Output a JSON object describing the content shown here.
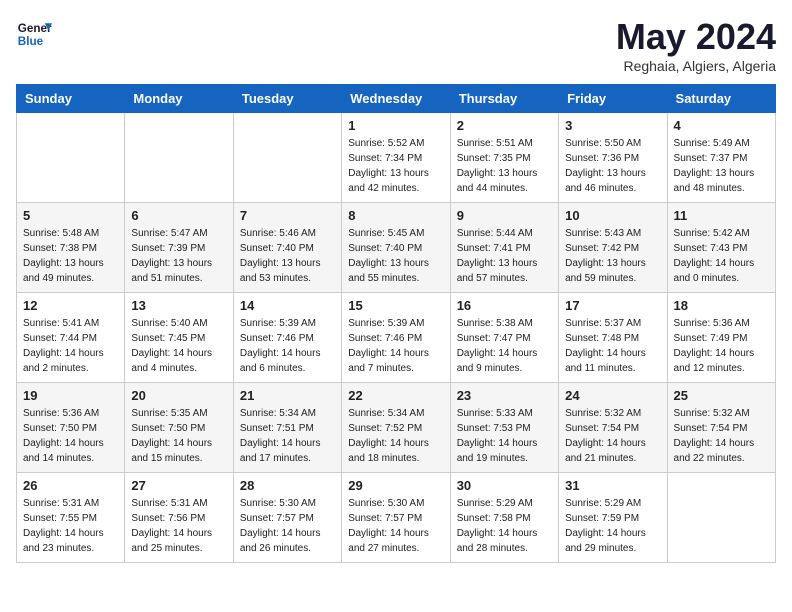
{
  "header": {
    "logo_line1": "General",
    "logo_line2": "Blue",
    "month_year": "May 2024",
    "location": "Reghaia, Algiers, Algeria"
  },
  "days_of_week": [
    "Sunday",
    "Monday",
    "Tuesday",
    "Wednesday",
    "Thursday",
    "Friday",
    "Saturday"
  ],
  "weeks": [
    [
      {
        "day": "",
        "info": ""
      },
      {
        "day": "",
        "info": ""
      },
      {
        "day": "",
        "info": ""
      },
      {
        "day": "1",
        "info": "Sunrise: 5:52 AM\nSunset: 7:34 PM\nDaylight: 13 hours\nand 42 minutes."
      },
      {
        "day": "2",
        "info": "Sunrise: 5:51 AM\nSunset: 7:35 PM\nDaylight: 13 hours\nand 44 minutes."
      },
      {
        "day": "3",
        "info": "Sunrise: 5:50 AM\nSunset: 7:36 PM\nDaylight: 13 hours\nand 46 minutes."
      },
      {
        "day": "4",
        "info": "Sunrise: 5:49 AM\nSunset: 7:37 PM\nDaylight: 13 hours\nand 48 minutes."
      }
    ],
    [
      {
        "day": "5",
        "info": "Sunrise: 5:48 AM\nSunset: 7:38 PM\nDaylight: 13 hours\nand 49 minutes."
      },
      {
        "day": "6",
        "info": "Sunrise: 5:47 AM\nSunset: 7:39 PM\nDaylight: 13 hours\nand 51 minutes."
      },
      {
        "day": "7",
        "info": "Sunrise: 5:46 AM\nSunset: 7:40 PM\nDaylight: 13 hours\nand 53 minutes."
      },
      {
        "day": "8",
        "info": "Sunrise: 5:45 AM\nSunset: 7:40 PM\nDaylight: 13 hours\nand 55 minutes."
      },
      {
        "day": "9",
        "info": "Sunrise: 5:44 AM\nSunset: 7:41 PM\nDaylight: 13 hours\nand 57 minutes."
      },
      {
        "day": "10",
        "info": "Sunrise: 5:43 AM\nSunset: 7:42 PM\nDaylight: 13 hours\nand 59 minutes."
      },
      {
        "day": "11",
        "info": "Sunrise: 5:42 AM\nSunset: 7:43 PM\nDaylight: 14 hours\nand 0 minutes."
      }
    ],
    [
      {
        "day": "12",
        "info": "Sunrise: 5:41 AM\nSunset: 7:44 PM\nDaylight: 14 hours\nand 2 minutes."
      },
      {
        "day": "13",
        "info": "Sunrise: 5:40 AM\nSunset: 7:45 PM\nDaylight: 14 hours\nand 4 minutes."
      },
      {
        "day": "14",
        "info": "Sunrise: 5:39 AM\nSunset: 7:46 PM\nDaylight: 14 hours\nand 6 minutes."
      },
      {
        "day": "15",
        "info": "Sunrise: 5:39 AM\nSunset: 7:46 PM\nDaylight: 14 hours\nand 7 minutes."
      },
      {
        "day": "16",
        "info": "Sunrise: 5:38 AM\nSunset: 7:47 PM\nDaylight: 14 hours\nand 9 minutes."
      },
      {
        "day": "17",
        "info": "Sunrise: 5:37 AM\nSunset: 7:48 PM\nDaylight: 14 hours\nand 11 minutes."
      },
      {
        "day": "18",
        "info": "Sunrise: 5:36 AM\nSunset: 7:49 PM\nDaylight: 14 hours\nand 12 minutes."
      }
    ],
    [
      {
        "day": "19",
        "info": "Sunrise: 5:36 AM\nSunset: 7:50 PM\nDaylight: 14 hours\nand 14 minutes."
      },
      {
        "day": "20",
        "info": "Sunrise: 5:35 AM\nSunset: 7:50 PM\nDaylight: 14 hours\nand 15 minutes."
      },
      {
        "day": "21",
        "info": "Sunrise: 5:34 AM\nSunset: 7:51 PM\nDaylight: 14 hours\nand 17 minutes."
      },
      {
        "day": "22",
        "info": "Sunrise: 5:34 AM\nSunset: 7:52 PM\nDaylight: 14 hours\nand 18 minutes."
      },
      {
        "day": "23",
        "info": "Sunrise: 5:33 AM\nSunset: 7:53 PM\nDaylight: 14 hours\nand 19 minutes."
      },
      {
        "day": "24",
        "info": "Sunrise: 5:32 AM\nSunset: 7:54 PM\nDaylight: 14 hours\nand 21 minutes."
      },
      {
        "day": "25",
        "info": "Sunrise: 5:32 AM\nSunset: 7:54 PM\nDaylight: 14 hours\nand 22 minutes."
      }
    ],
    [
      {
        "day": "26",
        "info": "Sunrise: 5:31 AM\nSunset: 7:55 PM\nDaylight: 14 hours\nand 23 minutes."
      },
      {
        "day": "27",
        "info": "Sunrise: 5:31 AM\nSunset: 7:56 PM\nDaylight: 14 hours\nand 25 minutes."
      },
      {
        "day": "28",
        "info": "Sunrise: 5:30 AM\nSunset: 7:57 PM\nDaylight: 14 hours\nand 26 minutes."
      },
      {
        "day": "29",
        "info": "Sunrise: 5:30 AM\nSunset: 7:57 PM\nDaylight: 14 hours\nand 27 minutes."
      },
      {
        "day": "30",
        "info": "Sunrise: 5:29 AM\nSunset: 7:58 PM\nDaylight: 14 hours\nand 28 minutes."
      },
      {
        "day": "31",
        "info": "Sunrise: 5:29 AM\nSunset: 7:59 PM\nDaylight: 14 hours\nand 29 minutes."
      },
      {
        "day": "",
        "info": ""
      }
    ]
  ]
}
